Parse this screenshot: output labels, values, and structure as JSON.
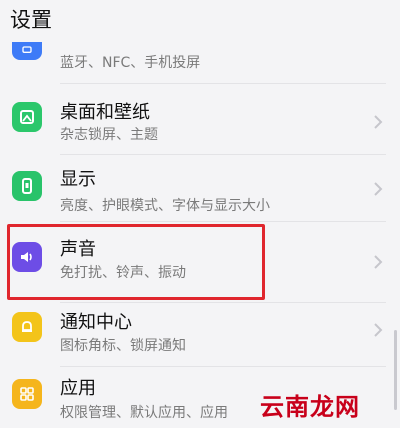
{
  "header": {
    "title": "设置"
  },
  "items": [
    {
      "label": "",
      "sub": "蓝牙、NFC、手机投屏",
      "icon": "connection-icon",
      "color": "#3e7bf7"
    },
    {
      "label": "桌面和壁纸",
      "sub": "杂志锁屏、主题",
      "icon": "wallpaper-icon",
      "color": "#2bc76b"
    },
    {
      "label": "显示",
      "sub": "亮度、护眼模式、字体与显示大小",
      "icon": "display-icon",
      "color": "#29c36a"
    },
    {
      "label": "声音",
      "sub": "免打扰、铃声、振动",
      "icon": "sound-icon",
      "color": "#6d4de6"
    },
    {
      "label": "通知中心",
      "sub": "图标角标、锁屏通知",
      "icon": "bell-icon",
      "color": "#f3c41a"
    },
    {
      "label": "应用",
      "sub": "权限管理、默认应用、应用",
      "icon": "apps-icon",
      "color": "#f5b51c"
    }
  ],
  "watermark": "云南龙网",
  "colors": {
    "highlight": "#e0262d",
    "background": "#f4f4f6"
  }
}
